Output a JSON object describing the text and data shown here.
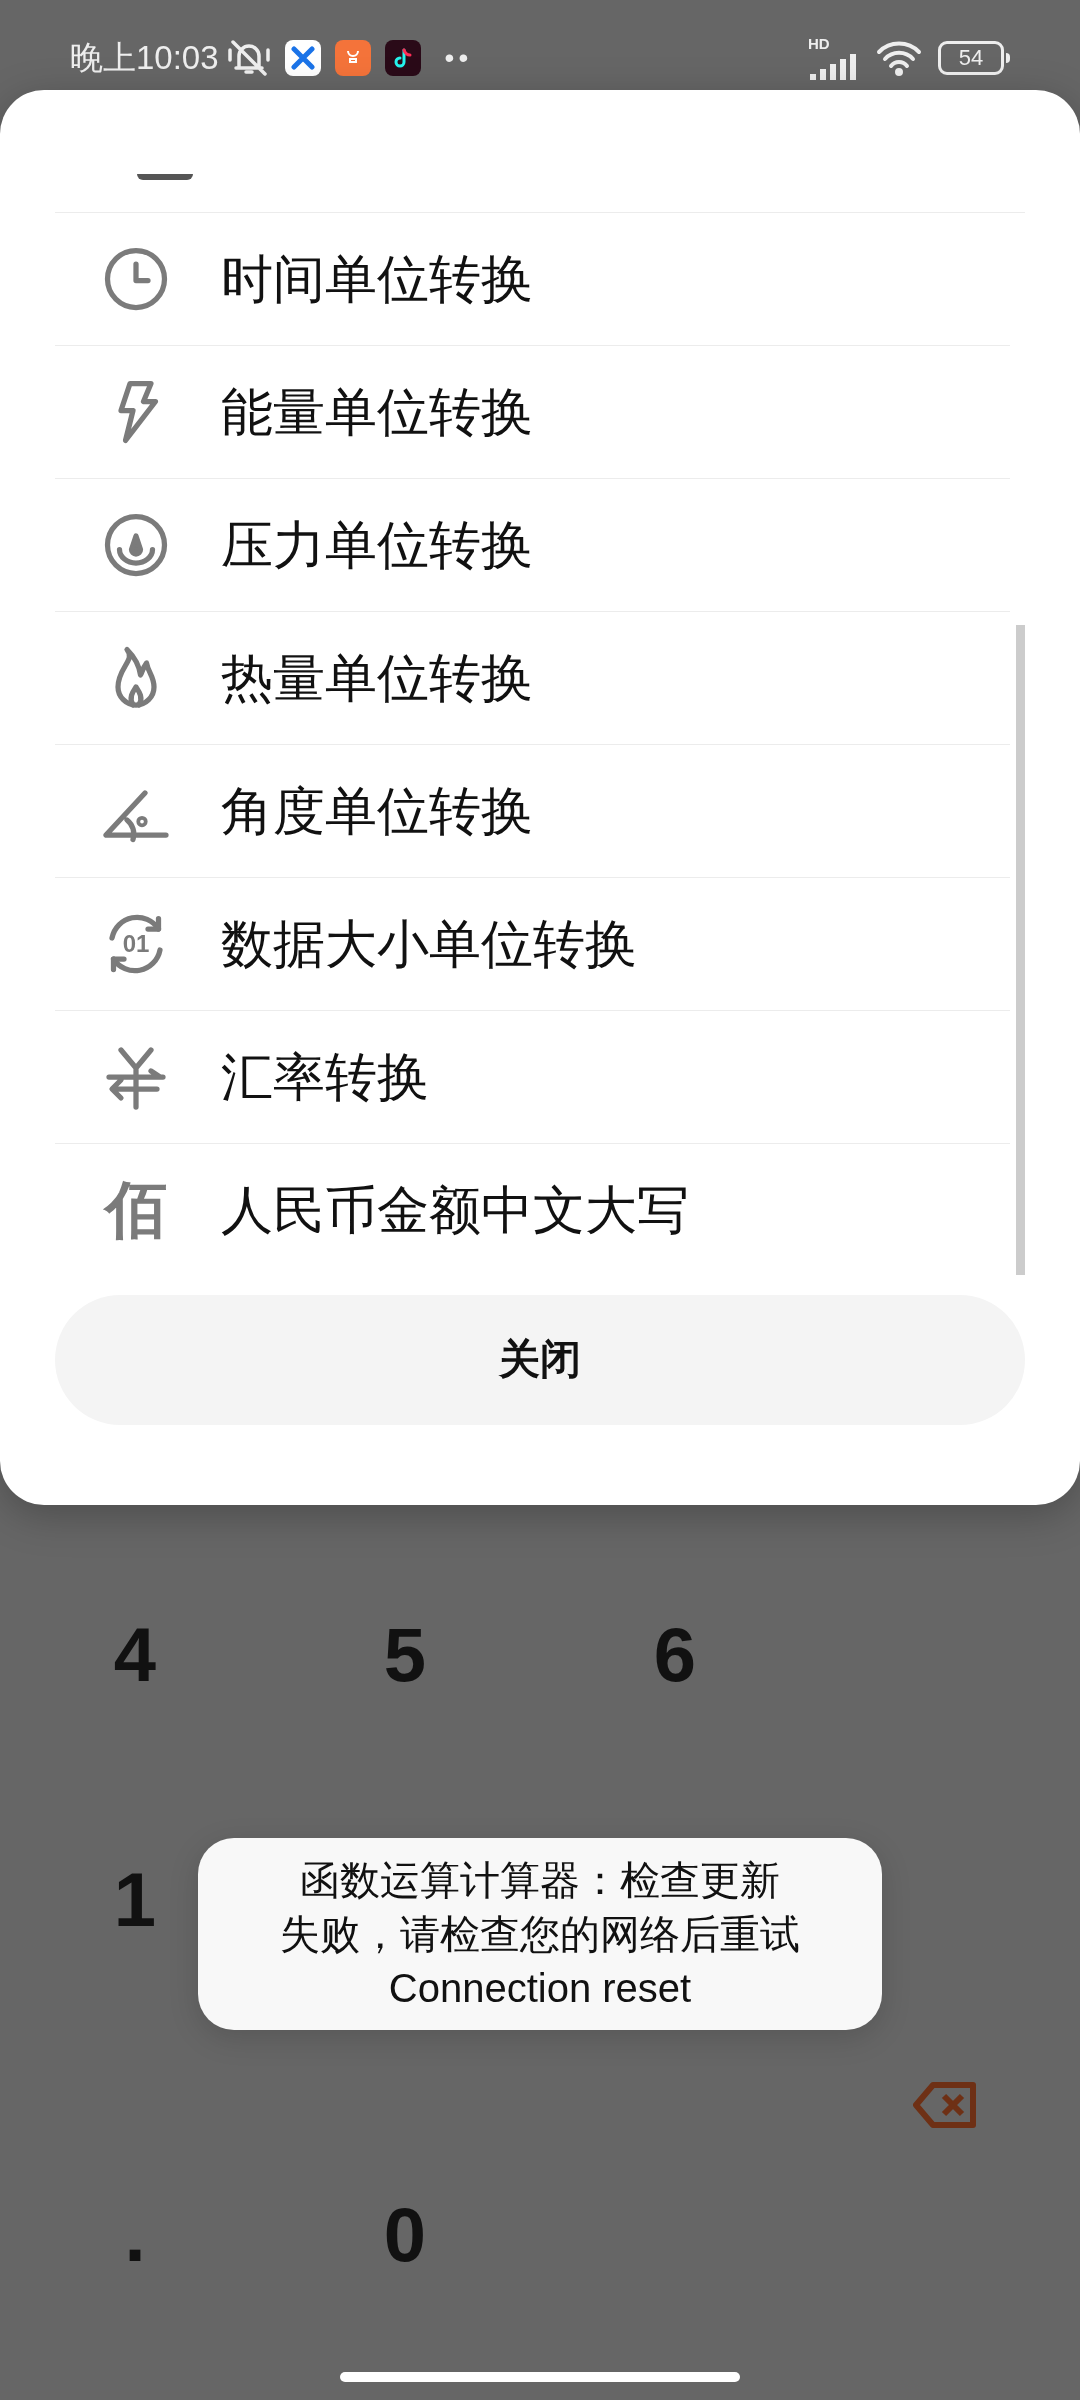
{
  "status_bar": {
    "time": "晚上10:03",
    "more": "••",
    "network": "HD",
    "battery": "54"
  },
  "sheet": {
    "items": [
      {
        "kind": "clock",
        "label": "时间单位转换"
      },
      {
        "kind": "bolt",
        "label": "能量单位转换"
      },
      {
        "kind": "gauge",
        "label": "压力单位转换"
      },
      {
        "kind": "flame",
        "label": "热量单位转换"
      },
      {
        "kind": "angle",
        "label": "角度单位转换"
      },
      {
        "kind": "data",
        "icon_text": "01",
        "label": "数据大小单位转换"
      },
      {
        "kind": "yen",
        "label": "汇率转换"
      },
      {
        "kind": "glyph",
        "icon_text": "佰",
        "label": "人民币金额中文大写"
      }
    ],
    "close_button": "关闭"
  },
  "keypad": {
    "rows": [
      [
        {
          "kind": "digit",
          "label": "4"
        },
        {
          "kind": "digit",
          "label": "5"
        },
        {
          "kind": "digit",
          "label": "6"
        }
      ],
      [
        {
          "kind": "digit",
          "label": "1"
        }
      ],
      [
        {
          "kind": "backspace"
        }
      ],
      [
        {
          "kind": "digit",
          "label": "."
        },
        {
          "kind": "digit",
          "label": "0"
        }
      ]
    ]
  },
  "toast": {
    "lines": [
      "函数运算计算器：检查更新",
      "失败，请检查您的网络后重试",
      "Connection reset"
    ]
  }
}
